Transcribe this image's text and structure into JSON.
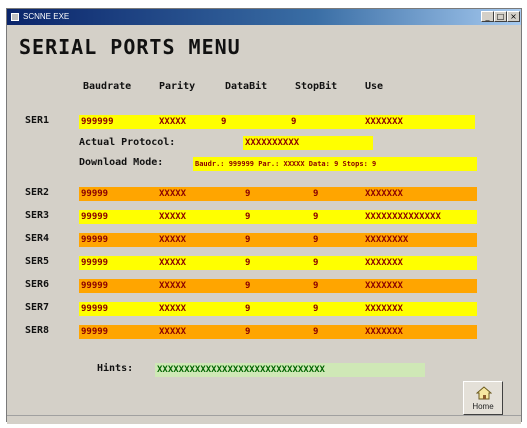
{
  "window": {
    "title": "SCNNE EXE"
  },
  "title": "SERIAL PORTS MENU",
  "headers": [
    "Baudrate",
    "Parity",
    "DataBit",
    "StopBit",
    "Use"
  ],
  "ports": [
    {
      "name": "SER1",
      "baud": "999999",
      "parity": "XXXXX",
      "data": "9",
      "stop": "9",
      "use": "XXXXXXX"
    },
    {
      "name": "SER2",
      "baud": "99999",
      "parity": "XXXXX",
      "data": "9",
      "stop": "9",
      "use": "XXXXXXX"
    },
    {
      "name": "SER3",
      "baud": "99999",
      "parity": "XXXXX",
      "data": "9",
      "stop": "9",
      "use": "XXXXXXXXXXXXXX"
    },
    {
      "name": "SER4",
      "baud": "99999",
      "parity": "XXXXX",
      "data": "9",
      "stop": "9",
      "use": "XXXXXXXX"
    },
    {
      "name": "SER5",
      "baud": "99999",
      "parity": "XXXXX",
      "data": "9",
      "stop": "9",
      "use": "XXXXXXX"
    },
    {
      "name": "SER6",
      "baud": "99999",
      "parity": "XXXXX",
      "data": "9",
      "stop": "9",
      "use": "XXXXXXX"
    },
    {
      "name": "SER7",
      "baud": "99999",
      "parity": "XXXXX",
      "data": "9",
      "stop": "9",
      "use": "XXXXXXX"
    },
    {
      "name": "SER8",
      "baud": "99999",
      "parity": "XXXXX",
      "data": "9",
      "stop": "9",
      "use": "XXXXXXX"
    }
  ],
  "protocol": {
    "label": "Actual Protocol:",
    "value": "XXXXXXXXXX"
  },
  "download": {
    "label": "Download Mode:",
    "value": "Baudr.: 999999  Par.: XXXXX  Data: 9  Stops: 9"
  },
  "hints": {
    "label": "Hints:",
    "value": "XXXXXXXXXXXXXXXXXXXXXXXXXXXXXXX"
  },
  "home": {
    "label": "Home",
    "icon": "home-icon"
  },
  "colors": {
    "yellow": "#ffff00",
    "orange": "#ffa500",
    "text": "#8b0000",
    "hints_bg": "#cfe8b6"
  }
}
